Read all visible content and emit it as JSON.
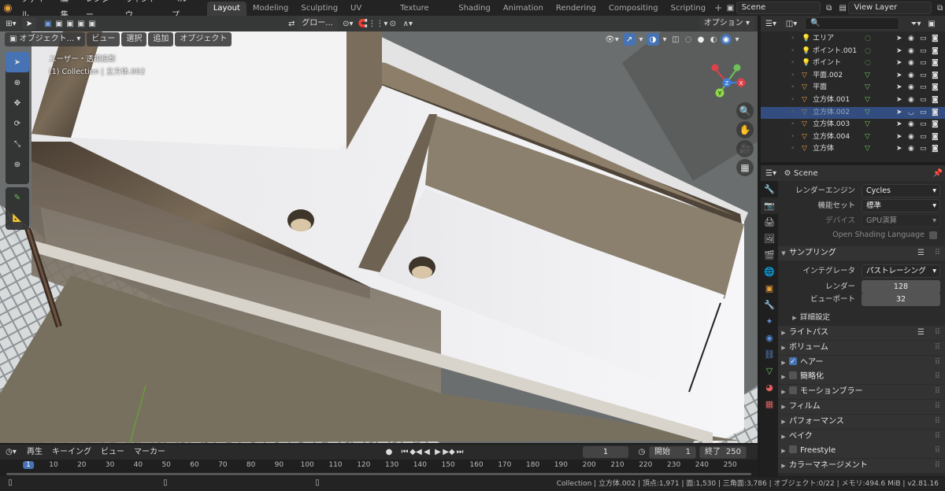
{
  "colors": {
    "accent": "#4772b3",
    "active_tab": "#3d3d3d",
    "bg": "#1d1d1d",
    "orange": "#e8a03a",
    "green": "#6ec15a"
  },
  "menu": [
    "ファイル",
    "編集",
    "レンダー",
    "ウィンドウ",
    "ヘルプ"
  ],
  "workspaces": [
    "Layout",
    "Modeling",
    "Sculpting",
    "UV Editing",
    "Texture Paint",
    "Shading",
    "Animation",
    "Rendering",
    "Compositing",
    "Scripting"
  ],
  "active_workspace": "Layout",
  "scene_name": "Scene",
  "view_layer": "View Layer",
  "viewport": {
    "mode": "オブジェクト...",
    "menus": [
      "ビュー",
      "選択",
      "追加",
      "オブジェクト"
    ],
    "transform": "グロー...",
    "options_label": "オプション",
    "overlay_title": "ユーザー・透視投影",
    "overlay_collection": "(1) Collection | 立方体.002",
    "gizmo_axes": [
      "X",
      "Y",
      "Z"
    ]
  },
  "outliner": {
    "items": [
      {
        "name": "エリア",
        "icon": "light-icon",
        "selected": false
      },
      {
        "name": "ポイント.001",
        "icon": "light-icon",
        "selected": false
      },
      {
        "name": "ポイント",
        "icon": "light-icon",
        "selected": false
      },
      {
        "name": "平面.002",
        "icon": "mesh-icon",
        "selected": false
      },
      {
        "name": "平面",
        "icon": "mesh-icon",
        "selected": false
      },
      {
        "name": "立方体.001",
        "icon": "mesh-icon",
        "selected": false
      },
      {
        "name": "立方体.002",
        "icon": "mesh-icon",
        "selected": true
      },
      {
        "name": "立方体.003",
        "icon": "mesh-icon",
        "selected": false
      },
      {
        "name": "立方体.004",
        "icon": "mesh-icon",
        "selected": false
      },
      {
        "name": "立方体",
        "icon": "mesh-icon",
        "selected": false
      }
    ]
  },
  "properties": {
    "context": "Scene",
    "render_engine_label": "レンダーエンジン",
    "render_engine": "Cycles",
    "feature_set_label": "機能セット",
    "feature_set": "標準",
    "device_label": "デバイス",
    "device": "GPU演算",
    "osl_label": "Open Shading Language",
    "sampling": {
      "title": "サンプリング",
      "integrator_label": "インテグレータ",
      "integrator": "パストレーシング",
      "render_label": "レンダー",
      "render": "128",
      "viewport_label": "ビューポート",
      "viewport": "32",
      "advanced": "詳細設定"
    },
    "panels": [
      {
        "name": "ライトパス",
        "checkbox": null
      },
      {
        "name": "ボリューム",
        "checkbox": null
      },
      {
        "name": "ヘアー",
        "checkbox": true
      },
      {
        "name": "簡略化",
        "checkbox": false
      },
      {
        "name": "モーションブラー",
        "checkbox": false
      },
      {
        "name": "フィルム",
        "checkbox": null
      },
      {
        "name": "パフォーマンス",
        "checkbox": null
      },
      {
        "name": "ベイク",
        "checkbox": null
      },
      {
        "name": "Freestyle",
        "checkbox": false
      },
      {
        "name": "カラーマネージメント",
        "checkbox": null
      }
    ]
  },
  "timeline": {
    "menus": [
      "再生",
      "キーイング",
      "ビュー",
      "マーカー"
    ],
    "current_frame": "1",
    "start_label": "開始",
    "start": "1",
    "end_label": "終了",
    "end": "250",
    "ticks": [
      "1",
      "10",
      "20",
      "30",
      "40",
      "50",
      "60",
      "70",
      "80",
      "90",
      "100",
      "110",
      "120",
      "130",
      "140",
      "150",
      "160",
      "170",
      "180",
      "190",
      "200",
      "210",
      "220",
      "230",
      "240",
      "250"
    ]
  },
  "status": "Collection | 立方体.002 | 頂点:1,971 | 面:1,530 | 三角面:3,786 | オブジェクト:0/22 | メモリ:494.6 MiB | v2.81.16"
}
